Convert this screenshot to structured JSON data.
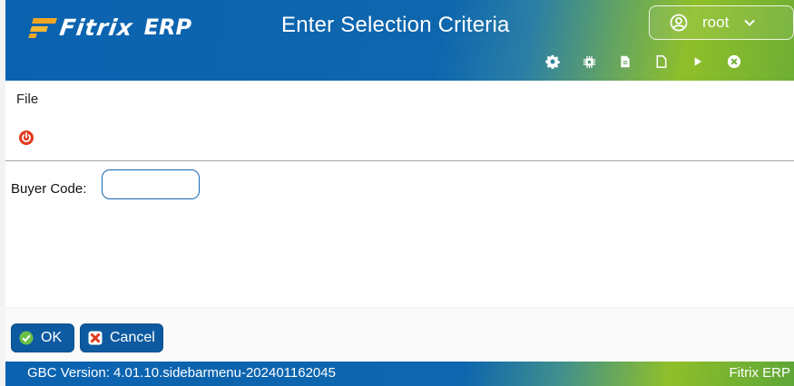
{
  "app": {
    "logo_text": "Fitrix",
    "logo_suffix": "ERP",
    "window_title": "Enter Selection Criteria"
  },
  "user": {
    "name": "root"
  },
  "toolbar": {
    "icons": [
      "gear-icon",
      "chip-icon",
      "document-icon",
      "new-page-icon",
      "play-icon",
      "close-circle-icon"
    ]
  },
  "menu": {
    "file_label": "File"
  },
  "form": {
    "buyer_code_label": "Buyer Code:",
    "buyer_code_value": ""
  },
  "actions": {
    "ok_label": "OK",
    "cancel_label": "Cancel"
  },
  "status": {
    "version_text": "GBC Version: 4.01.10.sidebarmenu-202401162045",
    "brand_text": "Fitrix ERP"
  },
  "colors": {
    "header_blue": "#0b63b0",
    "header_green": "#8fbf2a",
    "logo_orange": "#f5a623",
    "button_blue": "#0d5aa0",
    "power_red": "#e03a1e"
  }
}
